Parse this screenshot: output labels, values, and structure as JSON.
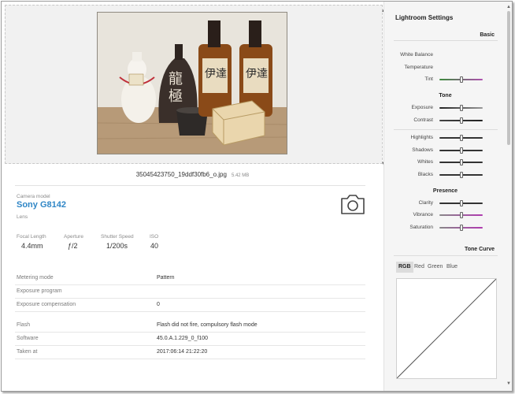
{
  "file": {
    "name": "35045423750_19ddf30fb6_o.jpg",
    "size": "5.42 MB"
  },
  "camera": {
    "model_label": "Camera model",
    "model": "Sony G8142",
    "lens_label": "Lens"
  },
  "exif": {
    "focal_label": "Focal Length",
    "focal": "4.4mm",
    "aperture_label": "Aperture",
    "aperture": "ƒ/2",
    "shutter_label": "Shutter Speed",
    "shutter": "1/200s",
    "iso_label": "ISO",
    "iso": "40"
  },
  "details": [
    {
      "key": "Metering mode",
      "value": "Pattern"
    },
    {
      "key": "Exposure program",
      "value": ""
    },
    {
      "key": "Exposure compensation",
      "value": "0"
    },
    {
      "key": "Flash",
      "value": "Flash did not fire, compulsory flash mode"
    },
    {
      "key": "Software",
      "value": "45.0.A.1.229_0_f100"
    },
    {
      "key": "Taken at",
      "value": "2017:06:14 21:22:20"
    }
  ],
  "panel": {
    "title": "Lightroom Settings",
    "basic": "Basic",
    "white_balance": "White Balance",
    "temperature": "Temperature",
    "tint": "Tint",
    "tone": "Tone",
    "exposure": "Exposure",
    "contrast": "Contrast",
    "highlights": "Highlights",
    "shadows": "Shadows",
    "whites": "Whites",
    "blacks": "Blacks",
    "presence": "Presence",
    "clarity": "Clarity",
    "vibrance": "Vibrance",
    "saturation": "Saturation",
    "tone_curve": "Tone Curve",
    "curve_tabs": [
      "RGB",
      "Red",
      "Green",
      "Blue"
    ]
  },
  "sliders": {
    "tint": 0.5,
    "exposure": 0.5,
    "contrast": 0.5,
    "highlights": 0.5,
    "shadows": 0.5,
    "whites": 0.5,
    "blacks": 0.5,
    "clarity": 0.5,
    "vibrance": 0.5,
    "saturation": 0.5
  },
  "colors": {
    "accent": "#2f86c6",
    "panel_bg": "#f5f5f5"
  }
}
